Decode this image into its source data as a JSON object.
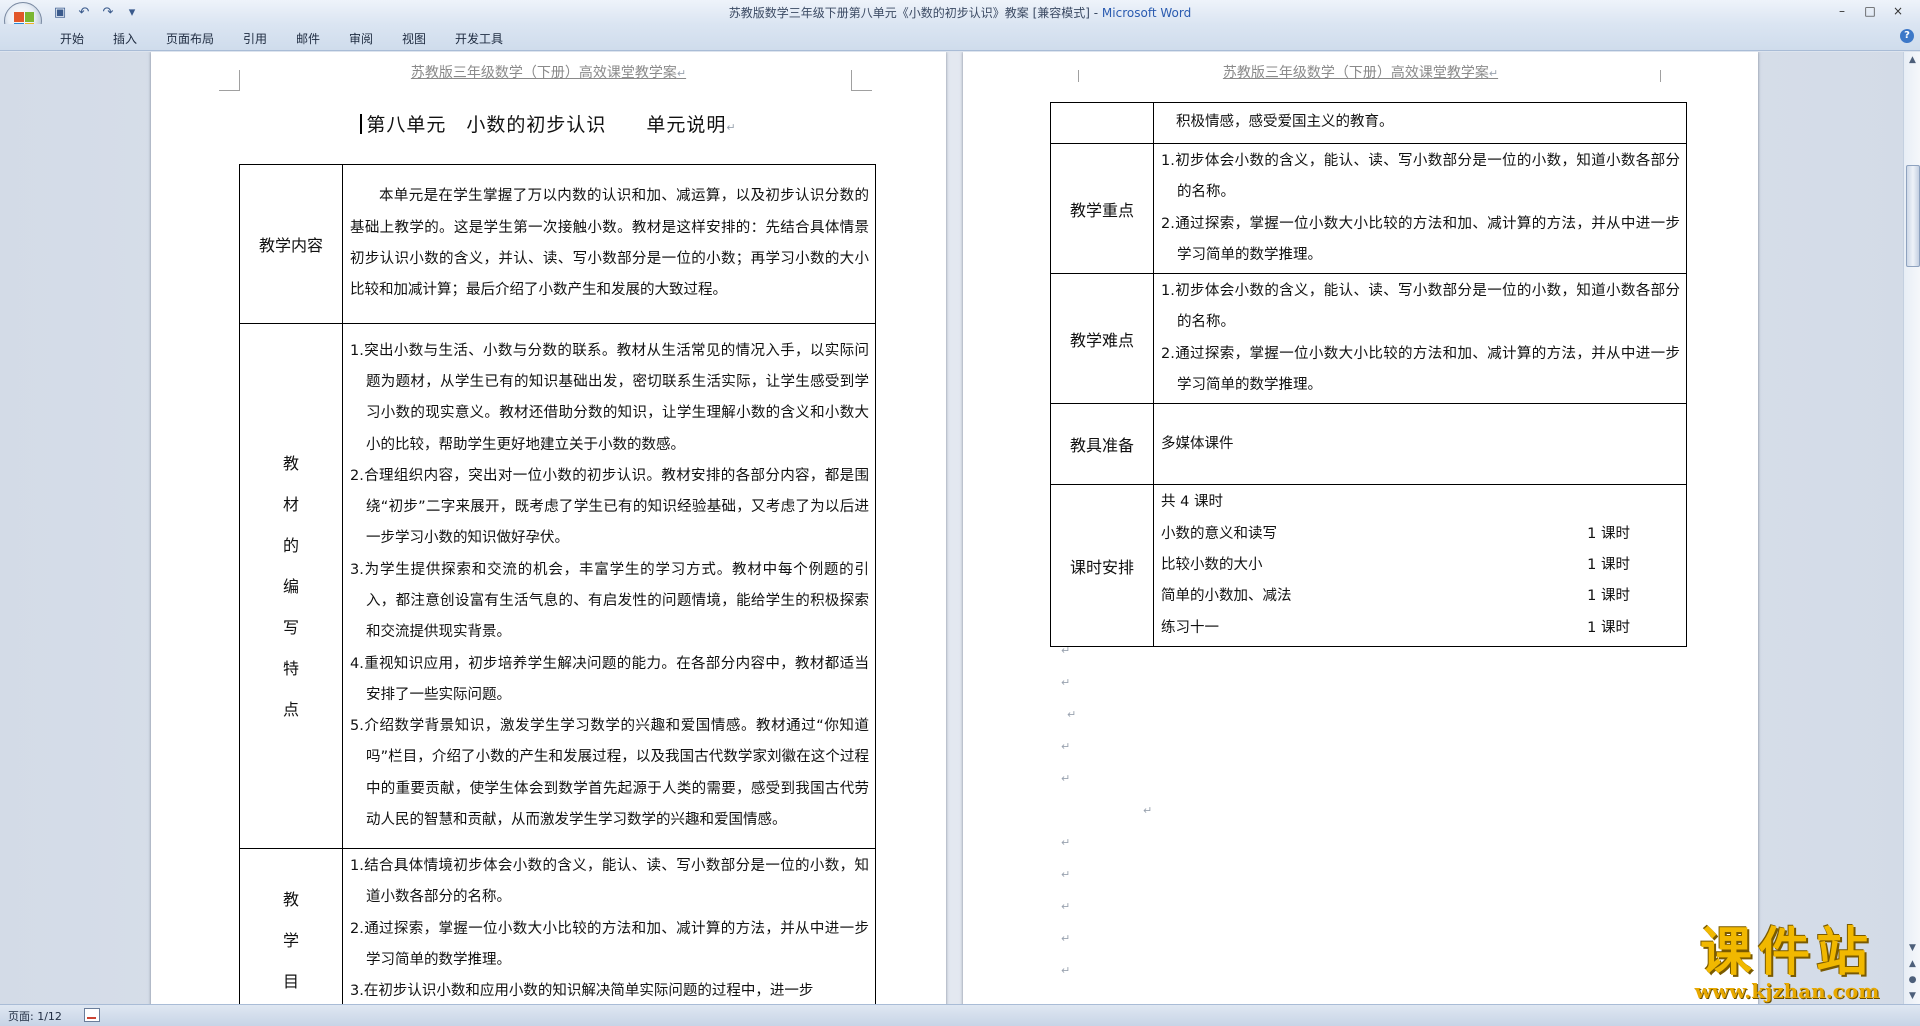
{
  "window": {
    "title_prefix": "苏教版数学三年级下册第八单元《小数的初步认识》教案 [兼容模式] - ",
    "app_name": "Microsoft Word",
    "controls": [
      "–",
      "□",
      "×"
    ]
  },
  "quick_access": [
    "save-icon",
    "undo-icon",
    "redo-icon",
    "customize-icon"
  ],
  "ribbon": {
    "tabs": [
      "开始",
      "插入",
      "页面布局",
      "引用",
      "邮件",
      "审阅",
      "视图",
      "开发工具"
    ]
  },
  "header_text": "苏教版三年级数学（下册）高效课堂教学案",
  "page1": {
    "title": "第八单元　小数的初步认识　　单元说明",
    "content_label": "教学内容",
    "content_text": "本单元是在学生掌握了万以内数的认识和加、减运算，以及初步认识分数的基础上教学的。这是学生第一次接触小数。教材是这样安排的：先结合具体情景初步认识小数的含义，并认、读、写小数部分是一位的小数；再学习小数的大小比较和加减计算；最后介绍了小数产生和发展的大致过程。",
    "features_label_chars": [
      "教",
      "材",
      "的",
      "编",
      "写",
      "特",
      "点"
    ],
    "features": [
      "1.突出小数与生活、小数与分数的联系。教材从生活常见的情况入手，以实际问题为题材，从学生已有的知识基础出发，密切联系生活实际，让学生感受到学习小数的现实意义。教材还借助分数的知识，让学生理解小数的含义和小数大小的比较，帮助学生更好地建立关于小数的数感。",
      "2.合理组织内容，突出对一位小数的初步认识。教材安排的各部分内容，都是围绕“初步”二字来展开，既考虑了学生已有的知识经验基础，又考虑了为以后进一步学习小数的知识做好孕伏。",
      "3.为学生提供探索和交流的机会，丰富学生的学习方式。教材中每个例题的引入，都注意创设富有生活气息的、有启发性的问题情境，能给学生的积极探索和交流提供现实背景。",
      "4.重视知识应用，初步培养学生解决问题的能力。在各部分内容中，教材都适当安排了一些实际问题。",
      "5.介绍数学背景知识，激发学生学习数学的兴趣和爱国情感。教材通过“你知道吗”栏目，介绍了小数的产生和发展过程，以及我国古代数学家刘徽在这个过程中的重要贡献，使学生体会到数学首先起源于人类的需要，感受到我国古代劳动人民的智慧和贡献，从而激发学生学习数学的兴趣和爱国情感。"
    ],
    "goals_label_chars": [
      "教",
      "学",
      "目"
    ],
    "goals": [
      "1.结合具体情境初步体会小数的含义，能认、读、写小数部分是一位的小数，知道小数各部分的名称。",
      "2.通过探索，掌握一位小数大小比较的方法和加、减计算的方法，并从中进一步学习简单的数学推理。",
      "3.在初步认识小数和应用小数的知识解决简单实际问题的过程中，进一步"
    ]
  },
  "page2": {
    "continued_text": "积极情感，感受爱国主义的教育。",
    "key_label": "教学重点",
    "key_points": [
      "1.初步体会小数的含义，能认、读、写小数部分是一位的小数，知道小数各部分的名称。",
      "2.通过探索，掌握一位小数大小比较的方法和加、减计算的方法，并从中进一步学习简单的数学推理。"
    ],
    "difficulty_label": "教学难点",
    "difficulty_points": [
      "1.初步体会小数的含义，能认、读、写小数部分是一位的小数，知道小数各部分的名称。",
      "2.通过探索，掌握一位小数大小比较的方法和加、减计算的方法，并从中进一步学习简单的数学推理。"
    ],
    "tools_label": "教具准备",
    "tools_text": "多媒体课件",
    "schedule_label": "课时安排",
    "schedule_total": "共 4 课时",
    "schedule": [
      {
        "name": "小数的意义和读写",
        "hours": "1 课时"
      },
      {
        "name": "比较小数的大小",
        "hours": "1 课时"
      },
      {
        "name": "简单的小数加、减法",
        "hours": "1 课时"
      },
      {
        "name": "练习十一",
        "hours": "1 课时"
      }
    ]
  },
  "statusbar": {
    "page_info": "页面: 1/12"
  },
  "watermark": {
    "title": "课件站",
    "url": "www.kjzhan.com"
  }
}
